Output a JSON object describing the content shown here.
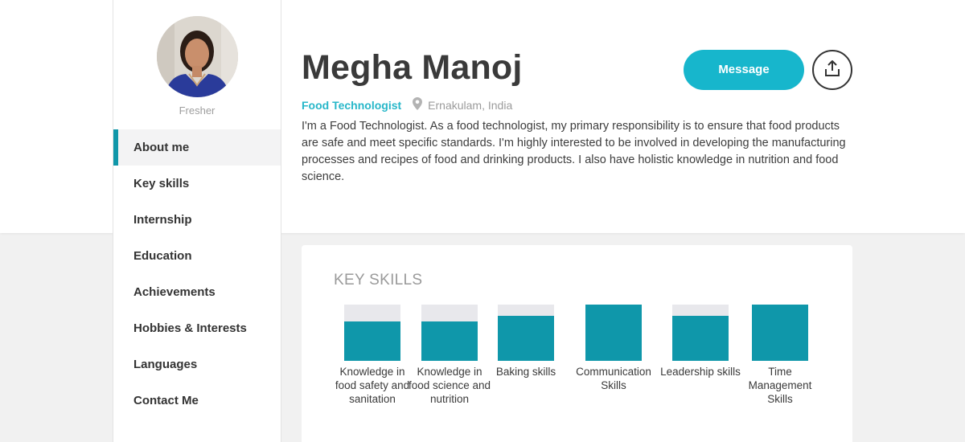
{
  "profile": {
    "name": "Megha Manoj",
    "status": "Fresher",
    "title": "Food Technologist",
    "location": "Ernakulam, India",
    "bio": "I'm a Food Technologist. As a food technologist, my primary responsibility is to ensure that food products are safe and meet specific standards. I'm highly interested to be involved in developing the manufacturing processes and recipes of food and drinking products. I also have holistic knowledge in nutrition and food science."
  },
  "actions": {
    "message_label": "Message",
    "share_icon": "share-icon"
  },
  "nav": {
    "items": [
      {
        "label": "About me",
        "active": true
      },
      {
        "label": "Key skills"
      },
      {
        "label": "Internship"
      },
      {
        "label": "Education"
      },
      {
        "label": "Achievements"
      },
      {
        "label": "Hobbies & Interests"
      },
      {
        "label": "Languages"
      },
      {
        "label": "Contact Me"
      }
    ]
  },
  "skills": {
    "heading": "KEY SKILLS",
    "items": [
      {
        "label": "Knowledge in food safety and sanitation",
        "level": 0.7
      },
      {
        "label": "Knowledge in food science and nutrition",
        "level": 0.7
      },
      {
        "label": "Baking skills",
        "level": 0.8
      },
      {
        "label": "Communication Skills",
        "level": 1.0
      },
      {
        "label": "Leadership skills",
        "level": 0.8
      },
      {
        "label": "Time Management Skills",
        "level": 1.0
      }
    ]
  },
  "colors": {
    "accent": "#17b6cc",
    "bar_fill": "#0f97aa",
    "bar_track": "#e8e8ec"
  }
}
